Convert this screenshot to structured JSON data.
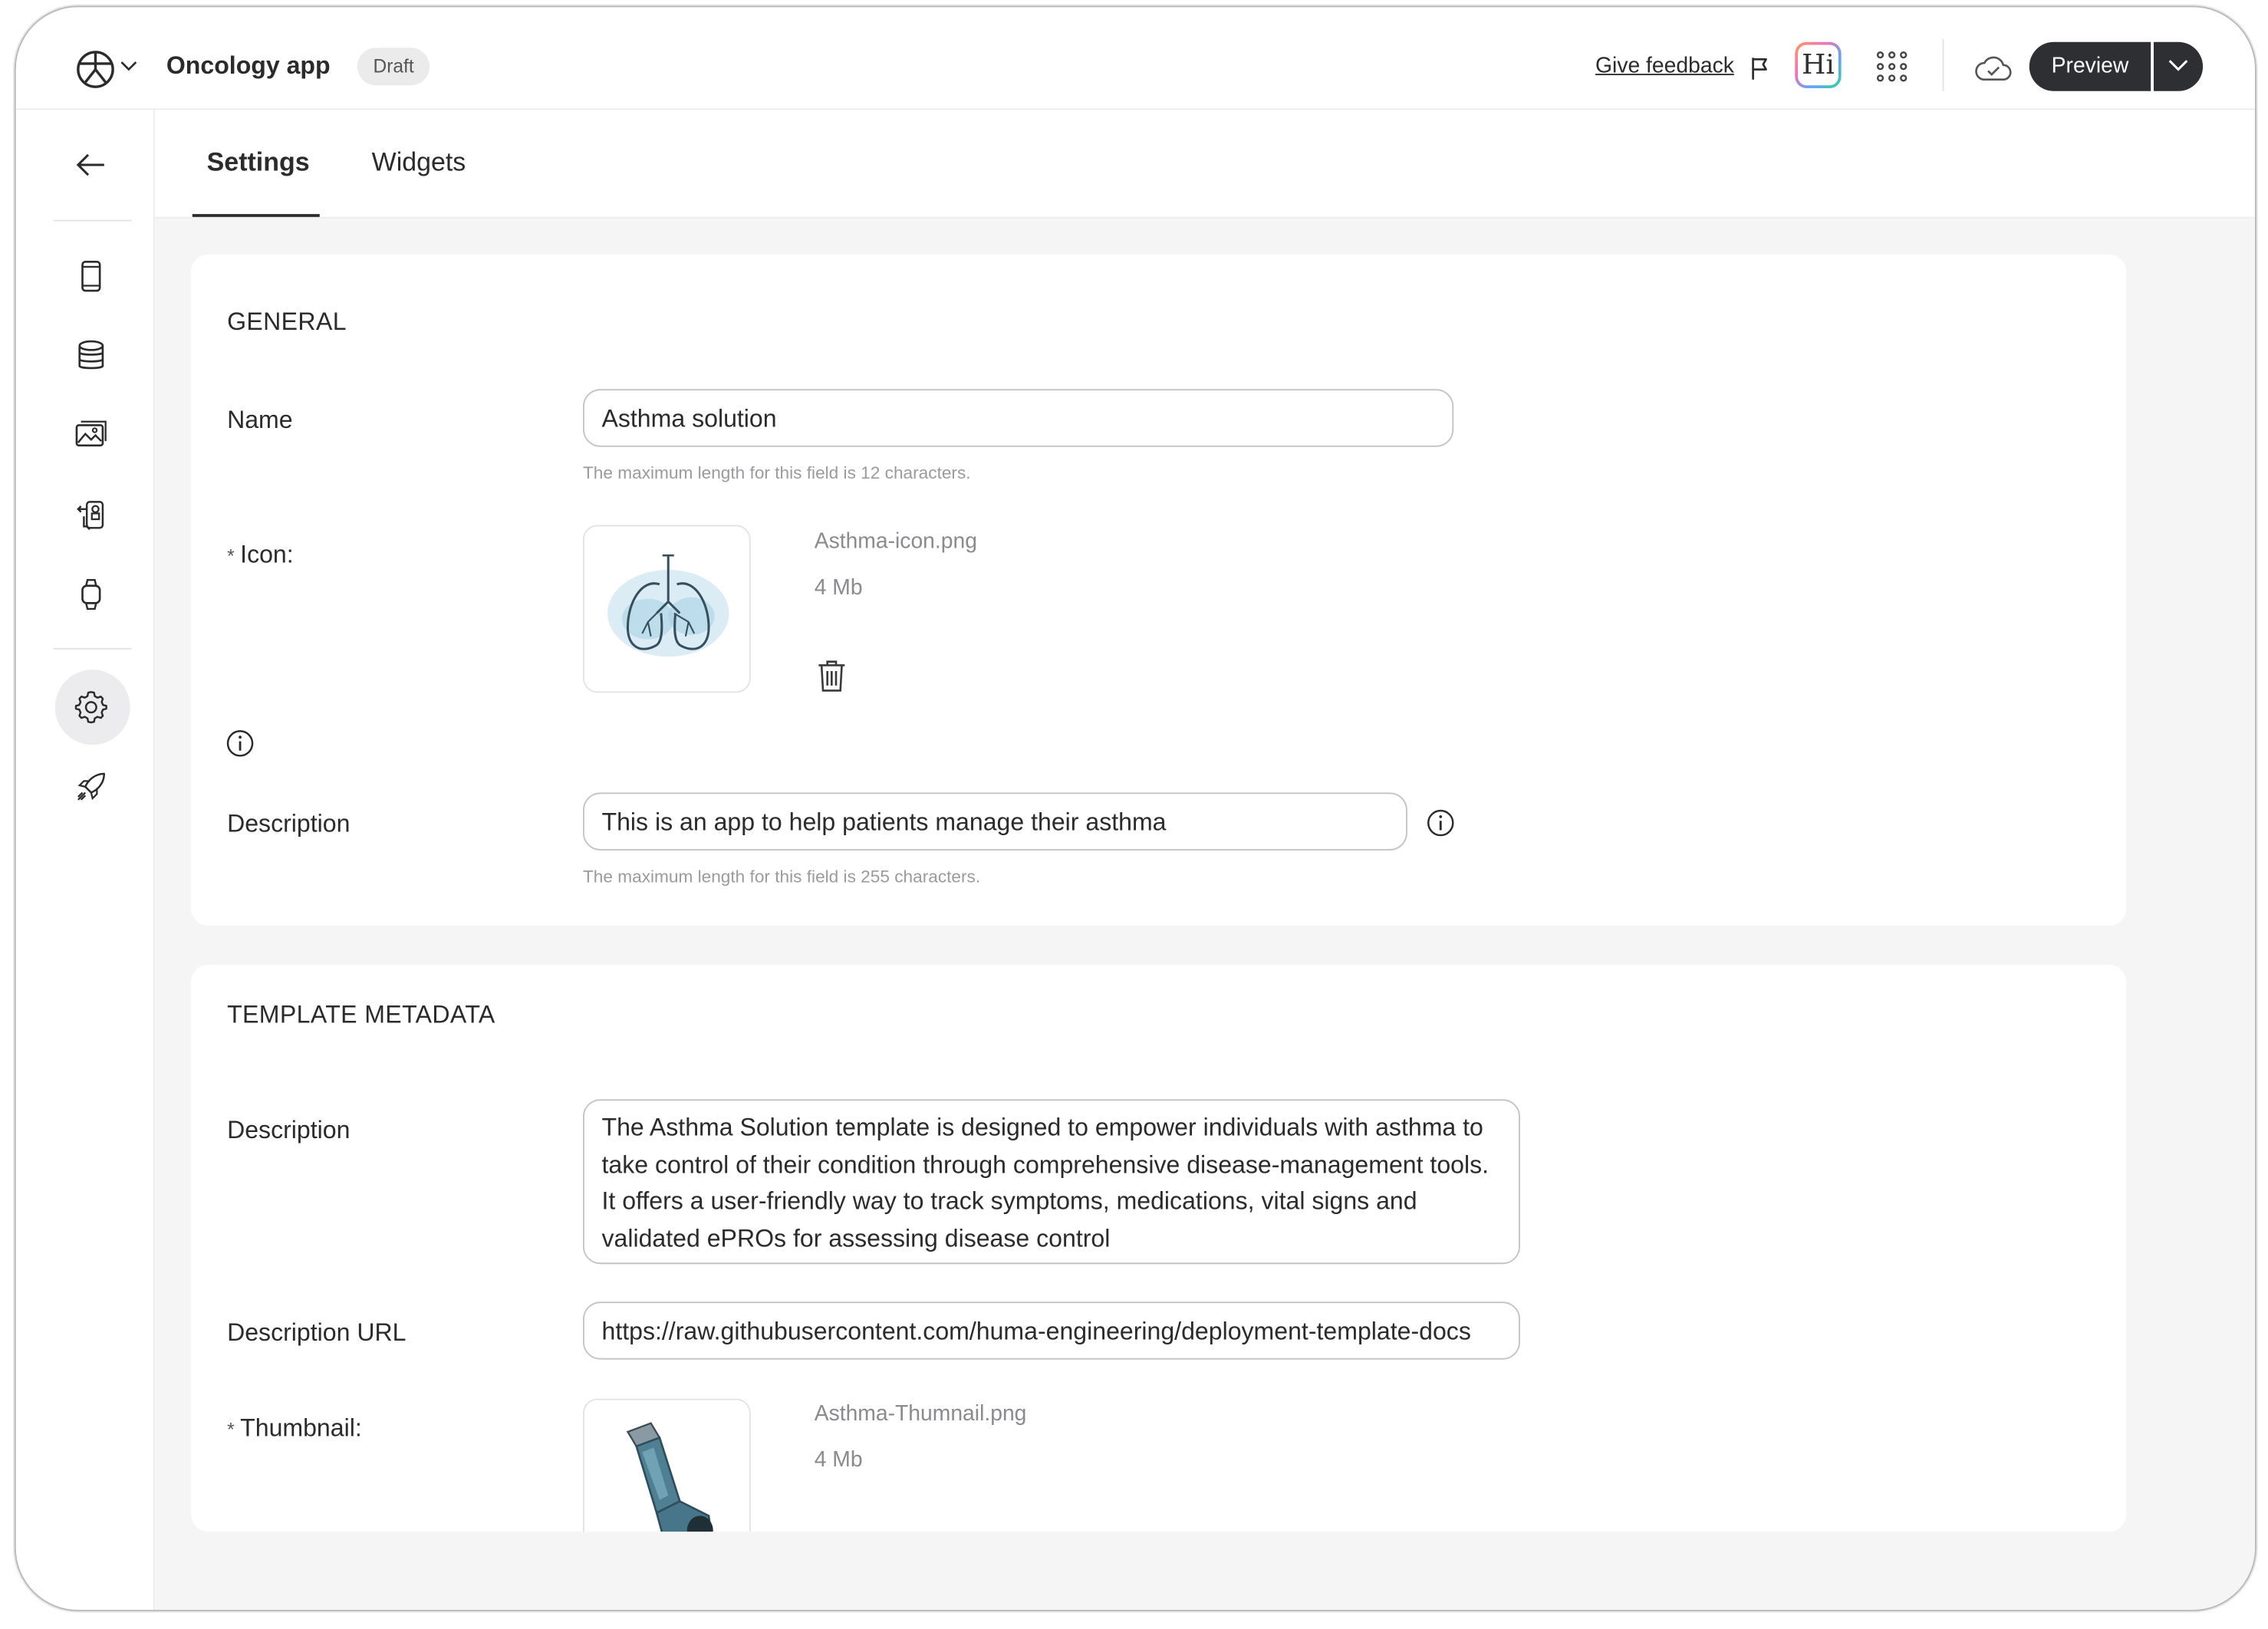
{
  "header": {
    "app_title": "Oncology app",
    "status_badge": "Draft",
    "feedback_label": "Give feedback",
    "hi_label": "Hi",
    "preview_label": "Preview"
  },
  "tabs": [
    {
      "label": "Settings",
      "active": true
    },
    {
      "label": "Widgets",
      "active": false
    }
  ],
  "general": {
    "section_title": "GENERAL",
    "name_label": "Name",
    "name_value": "Asthma solution",
    "name_hint": "The maximum length for this field is 12 characters.",
    "icon_required_mark": "*",
    "icon_label": "Icon:",
    "icon_file_name": "Asthma-icon.png",
    "icon_file_size": "4 Mb",
    "description_label": "Description",
    "description_value": "This is an app to help patients manage their asthma",
    "description_hint": "The maximum length for this field is 255 characters."
  },
  "template_metadata": {
    "section_title": "TEMPLATE METADATA",
    "description_label": "Description",
    "description_value": "The Asthma Solution template is designed to empower individuals with asthma to take control of their condition through comprehensive disease-management tools. It offers a user-friendly way to track symptoms, medications, vital signs and validated ePROs for assessing disease control",
    "url_label": "Description URL",
    "url_value": "https://raw.githubusercontent.com/huma-engineering/deployment-template-docs",
    "thumbnail_required_mark": "*",
    "thumbnail_label": "Thumbnail:",
    "thumbnail_file_name": "Asthma-Thumnail.png",
    "thumbnail_file_size": "4 Mb"
  },
  "colors": {
    "primary_dark": "#2d2f33",
    "active_nav_bg": "#ececee",
    "content_bg": "#f5f5f6"
  }
}
